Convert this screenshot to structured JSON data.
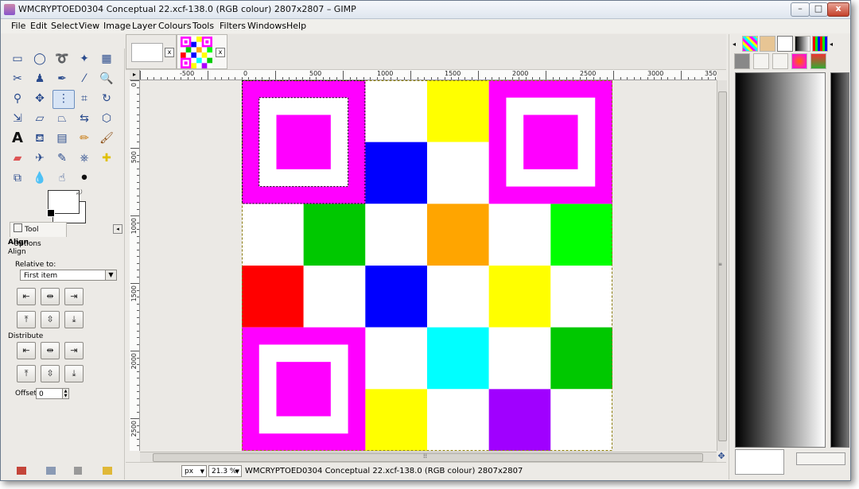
{
  "window": {
    "title": "WMCRYPTOED0304 Conceptual 22.xcf-138.0 (RGB colour) 2807x2807 – GIMP",
    "minimize_label": "–",
    "maximize_label": "□",
    "close_label": "x"
  },
  "menu": [
    "File",
    "Edit",
    "Select",
    "View",
    "Image",
    "Layer",
    "Colours",
    "Tools",
    "Filters",
    "Windows",
    "Help"
  ],
  "tool_options": {
    "tab_label": "Tool Options",
    "title": "Align",
    "subtitle": "Align",
    "relative_to_label": "Relative to:",
    "relative_to_value": "First item",
    "distribute_label": "Distribute",
    "offset_label": "Offset:",
    "offset_value": "0"
  },
  "rulers": {
    "h_labels": [
      "-500",
      "0",
      "500",
      "1000",
      "1500",
      "2000",
      "2500",
      "3000",
      "350"
    ],
    "v_labels": [
      "0",
      "500",
      "1000",
      "1500",
      "2000",
      "2500"
    ]
  },
  "status": {
    "unit": "px",
    "zoom": "21.3 %",
    "message": "WMCRYPTOED0304 Conceptual 22.xcf-138.0 (RGB colour) 2807x2807"
  },
  "colors": {
    "magenta": "#ff00ff",
    "white": "#ffffff",
    "yellow": "#ffff00",
    "blue": "#0000ff",
    "green": "#00c800",
    "orange": "#ffa500",
    "lime": "#00ff00",
    "red": "#ff0000",
    "cyan": "#00ffff",
    "purple": "#a000ff"
  },
  "image_grid": {
    "cols": 6,
    "rows": 6,
    "cells": [
      "",
      "",
      "white",
      "yellow",
      "",
      "",
      "",
      "",
      "blue",
      "white",
      "",
      "",
      "white",
      "green",
      "white",
      "orange",
      "white",
      "lime",
      "red",
      "white",
      "blue",
      "white",
      "yellow",
      "white",
      "",
      "",
      "white",
      "cyan",
      "white",
      "green",
      "",
      "",
      "yellow",
      "white",
      "purple",
      "white"
    ],
    "finder_patterns": [
      "top-left",
      "top-right",
      "bottom-left"
    ]
  }
}
